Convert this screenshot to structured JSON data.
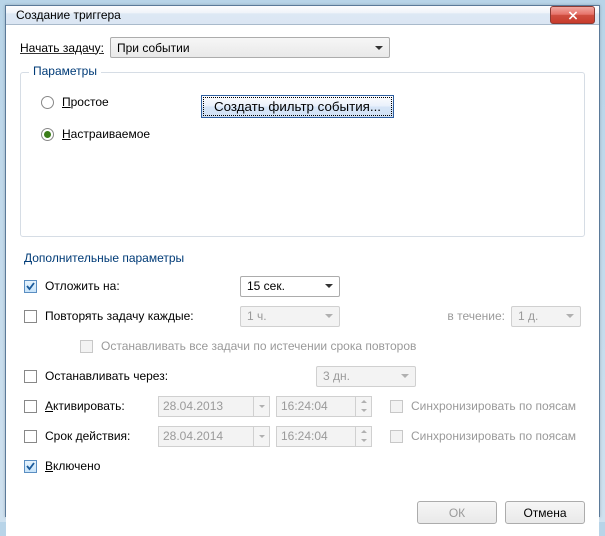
{
  "window": {
    "title": "Создание триггера"
  },
  "start": {
    "label": "Начать задачу:",
    "value": "При событии"
  },
  "params": {
    "title": "Параметры",
    "simple": "Простое",
    "custom": "Настраиваемое",
    "filter_btn": "Создать фильтр события..."
  },
  "adv": {
    "title": "Дополнительные параметры",
    "delay_label": "Отложить на:",
    "delay_value": "15 сек.",
    "repeat_label": "Повторять задачу каждые:",
    "repeat_value": "1 ч.",
    "during_label": "в течение:",
    "during_value": "1 д.",
    "stop_repeat": "Останавливать все задачи по истечении срока повторов",
    "stop_after_label": "Останавливать через:",
    "stop_after_value": "3 дн.",
    "activate_label": "Активировать:",
    "activate_date": "28.04.2013",
    "activate_time": "16:24:04",
    "expires_label": "Срок действия:",
    "expires_date": "28.04.2014",
    "expires_time": "16:24:04",
    "sync_tz": "Синхронизировать по поясам",
    "enabled": "Включено"
  },
  "buttons": {
    "ok": "ОК",
    "cancel": "Отмена"
  }
}
